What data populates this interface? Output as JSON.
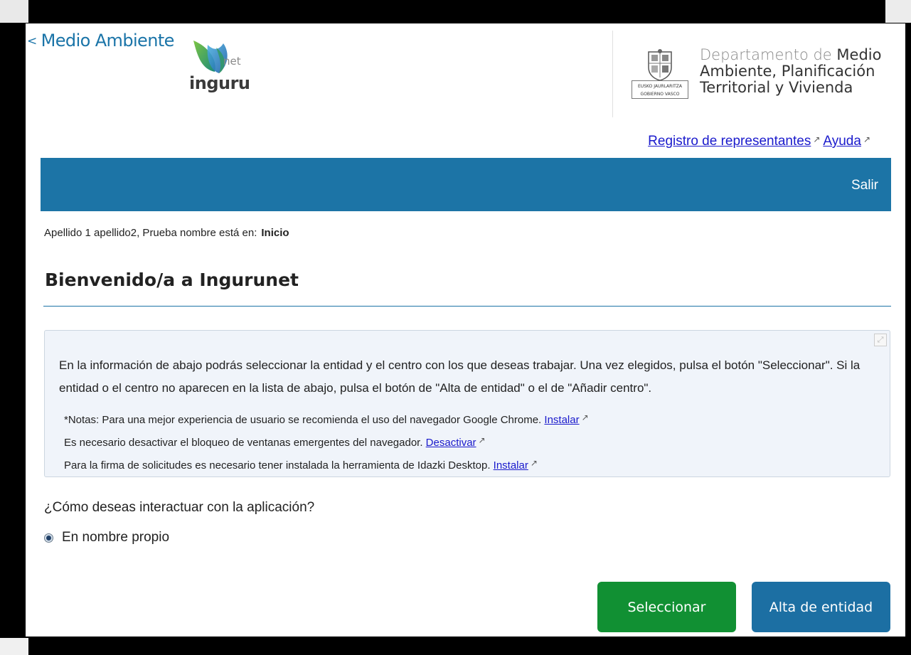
{
  "header": {
    "back_label": "Medio Ambiente",
    "logo_text": "inguru",
    "logo_suffix": "net",
    "emblem_label_1": "EUSKO JAURLARITZA",
    "emblem_label_2": "GOBIERNO VASCO",
    "dept_line1_light": "Departamento de",
    "dept_line1_strong": "Medio",
    "dept_line2": "Ambiente, Planificación",
    "dept_line3": "Territorial y Vivienda"
  },
  "top_links": {
    "registro": "Registro de representantes",
    "ayuda": "Ayuda"
  },
  "nav": {
    "salir": "Salir"
  },
  "breadcrumb": {
    "prefix": "Apellido 1 apellido2, Prueba nombre está en:",
    "current": "Inicio"
  },
  "page_title": "Bienvenido/a a Ingurunet",
  "info": {
    "main_text": "En la información de abajo podrás seleccionar la entidad y el centro con los que deseas trabajar. Una vez elegidos, pulsa el botón \"Seleccionar\". Si la entidad o el centro no aparecen en la lista de abajo, pulsa el botón de \"Alta de entidad\" o el de \"Añadir centro\".",
    "note1_text": "*Notas: Para una mejor experiencia de usuario se recomienda el uso del navegador Google Chrome.",
    "note1_link": "Instalar",
    "note2_text": "Es necesario desactivar el bloqueo de ventanas emergentes del navegador.",
    "note2_link": "Desactivar",
    "note3_text": "Para la firma de solicitudes es necesario tener instalada la herramienta de Idazki Desktop.",
    "note3_link": "Instalar"
  },
  "question": "¿Cómo deseas interactuar con la aplicación?",
  "radio_option": {
    "label": "En nombre propio",
    "checked": true
  },
  "buttons": {
    "select": "Seleccionar",
    "alta": "Alta de entidad"
  },
  "colors": {
    "brand_blue": "#1c74a6",
    "select_green": "#119033",
    "link_blue": "#1a1acc"
  }
}
